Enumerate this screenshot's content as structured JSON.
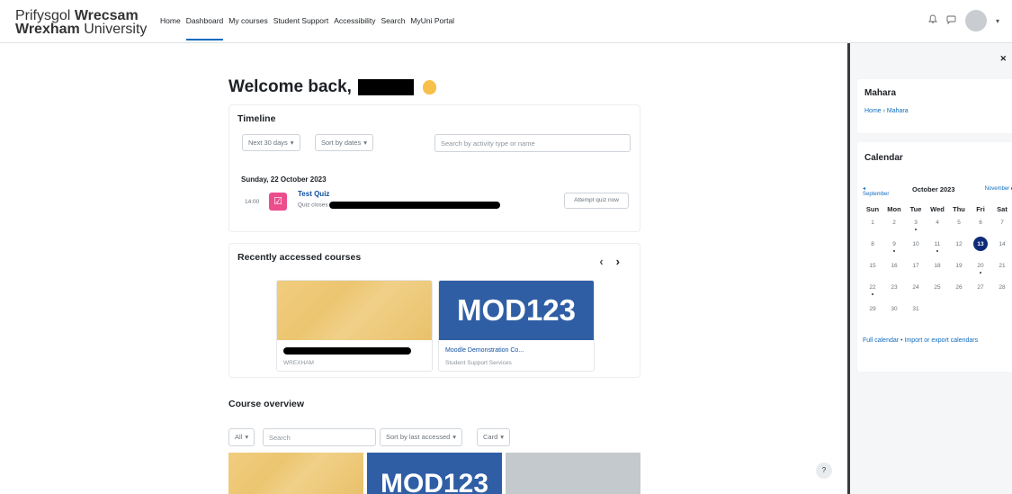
{
  "logo": {
    "line1_regular": "Prifysgol",
    "line1_bold": "Wrecsam",
    "line2_bold": "Wrexham",
    "line2_regular": "University"
  },
  "nav": {
    "links": [
      "Home",
      "Dashboard",
      "My courses",
      "Student Support",
      "Accessibility",
      "Search",
      "MyUni Portal"
    ],
    "active": "Dashboard",
    "icons": [
      "bell-icon",
      "chat-icon"
    ]
  },
  "welcome": {
    "text": "Welcome back,"
  },
  "timeline": {
    "title": "Timeline",
    "filter_days": "Next 30 days",
    "sort": "Sort by dates",
    "search_placeholder": "Search by activity type or name",
    "date": "Sunday, 22 October 2023",
    "time": "14:00",
    "quiz_title": "Test Quiz",
    "quiz_sub": "Quiz closes",
    "attempt_button": "Attempt quiz now"
  },
  "recent": {
    "title": "Recently accessed courses",
    "courses": [
      {
        "name": "",
        "category": "WREXHAM",
        "thumb": "yellow"
      },
      {
        "name": "Moodle Demonstration Co...",
        "category": "Student Support Services",
        "thumb": "MOD123"
      }
    ]
  },
  "overview": {
    "title": "Course overview",
    "filter": "All",
    "search_placeholder": "Search",
    "sort": "Sort by last accessed",
    "view": "Card",
    "thumb_text": "MOD123"
  },
  "drawer": {
    "mahara": {
      "title": "Mahara",
      "crumb": "Home › Mahara"
    },
    "calendar": {
      "title": "Calendar",
      "prev": "September",
      "month": "October 2023",
      "next": "November",
      "day_headers": [
        "Sun",
        "Mon",
        "Tue",
        "Wed",
        "Thu",
        "Fri",
        "Sat"
      ],
      "weeks": [
        [
          "1",
          "2",
          "3",
          "4",
          "5",
          "6",
          "7"
        ],
        [
          "8",
          "9",
          "10",
          "11",
          "12",
          "13",
          "14"
        ],
        [
          "15",
          "16",
          "17",
          "18",
          "19",
          "20",
          "21"
        ],
        [
          "22",
          "23",
          "24",
          "25",
          "26",
          "27",
          "28"
        ],
        [
          "29",
          "30",
          "31",
          "",
          "",
          "",
          ""
        ]
      ],
      "today": "13",
      "full_link": "Full calendar",
      "separator": "•",
      "export_link": "Import or export calendars"
    }
  },
  "help": "?"
}
